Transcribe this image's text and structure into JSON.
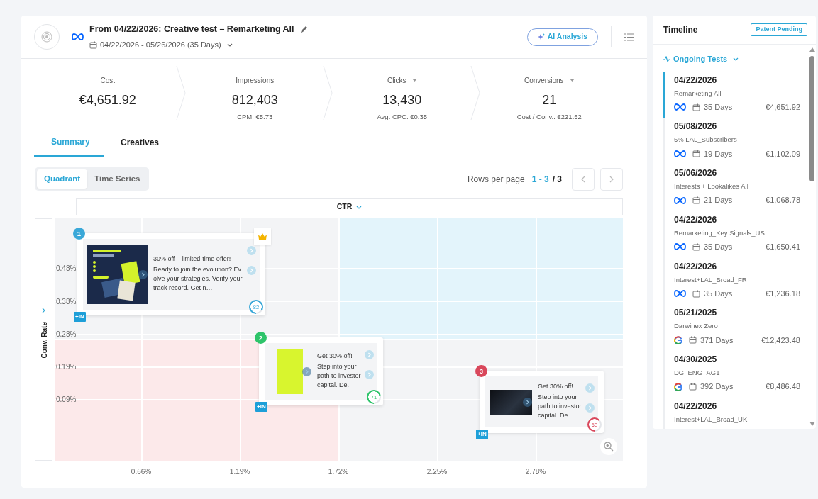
{
  "header": {
    "title": "From 04/22/2026: Creative test – Remarketing All",
    "date_range": "04/22/2026 - 05/26/2026 (35 Days)",
    "ai_button": "AI Analysis"
  },
  "metrics": [
    {
      "label": "Cost",
      "value": "€4,651.92",
      "has_menu": false
    },
    {
      "label": "Impressions",
      "value": "812,403",
      "sub": "CPM: €5.73",
      "has_menu": false
    },
    {
      "label": "Clicks",
      "value": "13,430",
      "sub": "Avg. CPC: €0.35",
      "has_menu": true
    },
    {
      "label": "Conversions",
      "value": "21",
      "sub": "Cost / Conv.: €221.52",
      "has_menu": true
    }
  ],
  "tabs": [
    {
      "label": "Summary",
      "selected": true
    },
    {
      "label": "Creatives",
      "selected": false
    }
  ],
  "view_toggle": [
    {
      "label": "Quadrant",
      "selected": true
    },
    {
      "label": "Time Series",
      "selected": false
    }
  ],
  "pagination": {
    "label": "Rows per page",
    "range": "1 - 3",
    "total": "/ 3"
  },
  "quadrant": {
    "x_metric": "CTR",
    "y_metric": "Conv. Rate",
    "y_ticks": [
      "0.48%",
      "0.38%",
      "0.28%",
      "0.19%",
      "0.09%"
    ],
    "x_ticks": [
      "0.66%",
      "1.19%",
      "1.72%",
      "2.25%",
      "2.78%"
    ],
    "creatives": [
      {
        "rank": "1",
        "color": "#3aa8d8",
        "kind": "banner",
        "headline": "30% off – limited-time offer!",
        "body": "Ready to join the evolution? Evolve your strategies. Verify your track record. Get n…",
        "score": "82",
        "top": true,
        "tag": "+IN"
      },
      {
        "rank": "2",
        "color": "#2ec46a",
        "kind": "solid",
        "headline": "Get 30% off!",
        "body": "Step into your path to investor capital. De.",
        "score": "71",
        "top": false,
        "tag": "+IN"
      },
      {
        "rank": "3",
        "color": "#d9475b",
        "kind": "photo",
        "headline": "Get 30% off!",
        "body": "Step into your path to investor capital. De.",
        "score": "63",
        "top": false,
        "tag": "+IN"
      }
    ]
  },
  "timeline": {
    "title": "Timeline",
    "badge": "Patent Pending",
    "group": "Ongoing Tests",
    "tests": [
      {
        "date": "04/22/2026",
        "name": "Remarketing All",
        "kind": "meta",
        "days": "35 Days",
        "cost": "€4,651.92",
        "selected": true
      },
      {
        "date": "05/08/2026",
        "name": "5% LAL_Subscribers",
        "kind": "meta",
        "days": "19 Days",
        "cost": "€1,102.09",
        "selected": false
      },
      {
        "date": "05/06/2026",
        "name": "Interests + Lookalikes All",
        "kind": "meta",
        "days": "21 Days",
        "cost": "€1,068.78",
        "selected": false
      },
      {
        "date": "04/22/2026",
        "name": "Remarketing_Key Signals_US",
        "kind": "meta",
        "days": "35 Days",
        "cost": "€1,650.41",
        "selected": false
      },
      {
        "date": "04/22/2026",
        "name": "Interest+LAL_Broad_FR",
        "kind": "meta",
        "days": "35 Days",
        "cost": "€1,236.18",
        "selected": false
      },
      {
        "date": "05/21/2025",
        "name": "Darwinex Zero",
        "kind": "google",
        "days": "371 Days",
        "cost": "€12,423.48",
        "selected": false
      },
      {
        "date": "04/30/2025",
        "name": "DG_ENG_AG1",
        "kind": "google",
        "days": "392 Days",
        "cost": "€8,486.48",
        "selected": false
      },
      {
        "date": "04/22/2026",
        "name": "Interest+LAL_Broad_UK",
        "selected": false
      }
    ]
  }
}
